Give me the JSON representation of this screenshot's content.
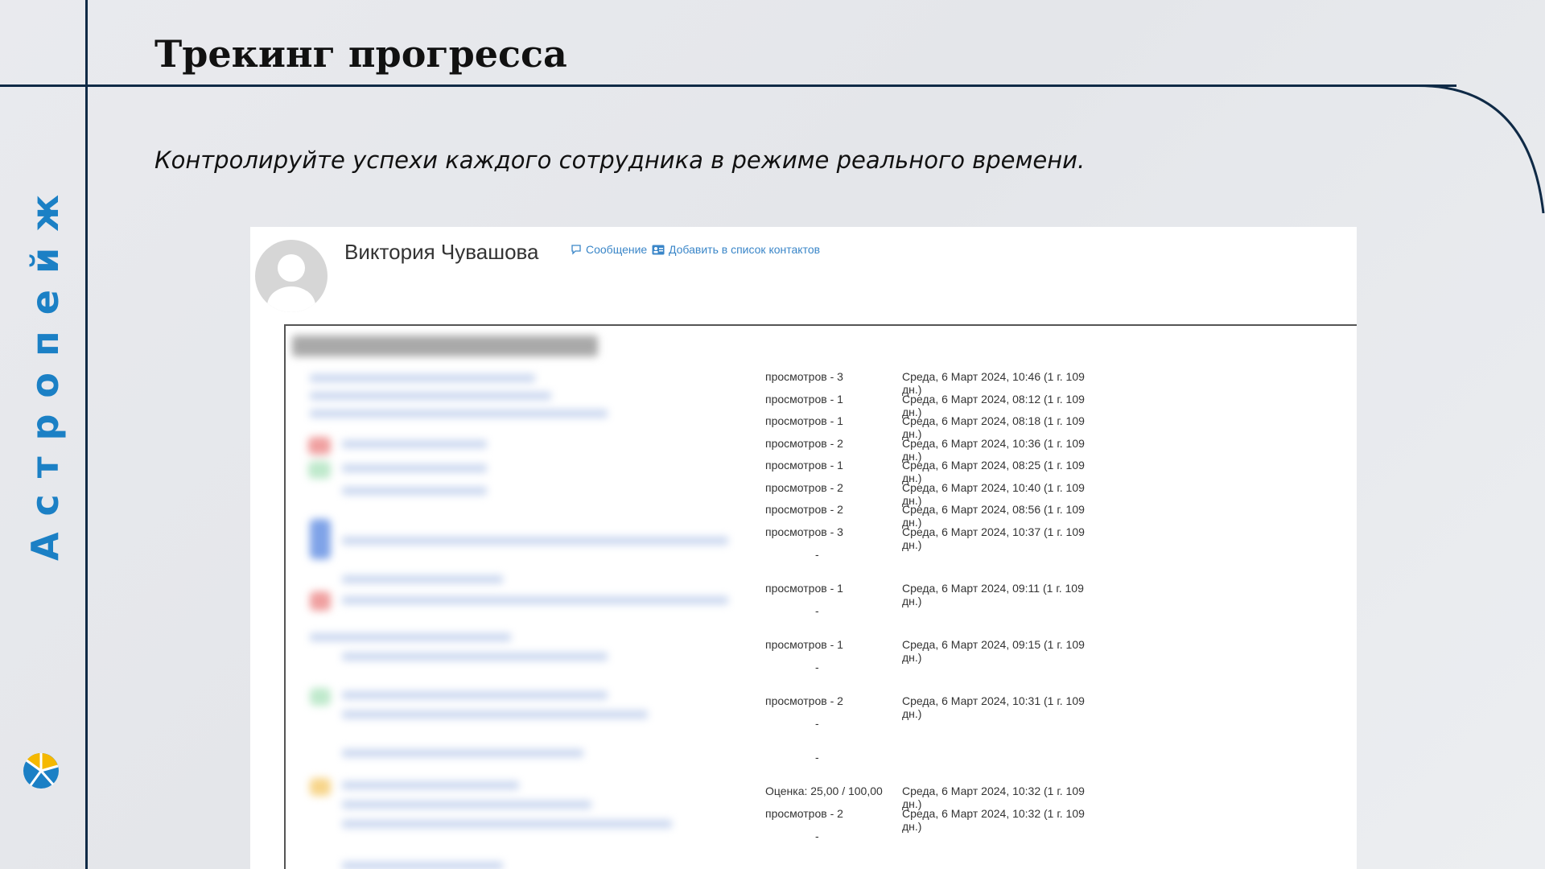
{
  "slide": {
    "title": "Трекинг прогресса",
    "subtitle": "Контролируйте успехи каждого сотрудника в режиме реального времени.",
    "brand_name": "Астропейж",
    "logo_icon": "brand-logo-icon",
    "accent_color": "#1b80c5",
    "line_color": "#0f2a46"
  },
  "profile": {
    "name": "Виктория Чувашова",
    "message_label": "Сообщение",
    "add_contact_label": "Добавить в список контактов"
  },
  "activity_rows": [
    {
      "views": "просмотров - 3",
      "date": "Среда, 6 Март 2024, 10:46 (1 г. 109 дн.)"
    },
    {
      "views": "просмотров - 1",
      "date": "Среда, 6 Март 2024, 08:12 (1 г. 109 дн.)"
    },
    {
      "views": "просмотров - 1",
      "date": "Среда, 6 Март 2024, 08:18 (1 г. 109 дн.)"
    },
    {
      "views": "просмотров - 2",
      "date": "Среда, 6 Март 2024, 10:36 (1 г. 109 дн.)"
    },
    {
      "views": "просмотров - 1",
      "date": "Среда, 6 Март 2024, 08:25 (1 г. 109 дн.)"
    },
    {
      "views": "просмотров - 2",
      "date": "Среда, 6 Март 2024, 10:40 (1 г. 109 дн.)"
    },
    {
      "views": "просмотров - 2",
      "date": "Среда, 6 Март 2024, 08:56 (1 г. 109 дн.)"
    },
    {
      "views": "просмотров - 3",
      "date": "Среда, 6 Март 2024, 10:37 (1 г. 109 дн.)"
    },
    {
      "dash": "-"
    },
    {
      "views": "просмотров - 1",
      "date": "Среда, 6 Март 2024, 09:11 (1 г. 109 дн.)"
    },
    {
      "dash": "-"
    },
    {
      "views": "просмотров - 1",
      "date": "Среда, 6 Март 2024, 09:15 (1 г. 109 дн.)"
    },
    {
      "dash": "-"
    },
    {
      "views": "просмотров - 2",
      "date": "Среда, 6 Март 2024, 10:31 (1 г. 109 дн.)"
    },
    {
      "dash": "-"
    },
    {
      "dash": "-"
    },
    {
      "views": "Оценка: 25,00 / 100,00",
      "date": "Среда, 6 Март 2024, 10:32 (1 г. 109 дн.)"
    },
    {
      "views": "просмотров - 2",
      "date": "Среда, 6 Март 2024, 10:32 (1 г. 109 дн.)"
    },
    {
      "dash": "-"
    },
    {
      "dash": "-"
    }
  ]
}
